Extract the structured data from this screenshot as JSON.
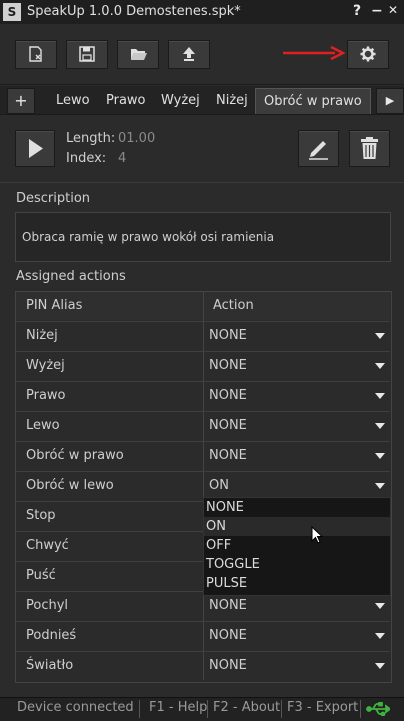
{
  "window": {
    "app_icon_text": "S",
    "title": "SpeakUp 1.0.0  Demostenes.spk*",
    "help": "?",
    "minimize": "−",
    "close": "✕"
  },
  "toolbar": {
    "buttons": [
      "new-file-icon",
      "save-icon",
      "open-folder-icon",
      "upload-icon"
    ],
    "settings_icon": "gear-icon",
    "annotation_color": "#e02020"
  },
  "tabs": {
    "add_label": "+",
    "items": [
      "Lewo",
      "Prawo",
      "Wyżej",
      "Niżej"
    ],
    "active": "Obróć w prawo",
    "next_label": "▶"
  },
  "playback": {
    "length_label": "Length:",
    "length_value": "01.00",
    "index_label": "Index:",
    "index_value": "4"
  },
  "description": {
    "label": "Description",
    "text": "Obraca ramię w prawo wokół osi ramienia"
  },
  "actions": {
    "label": "Assigned actions",
    "col_alias": "PIN Alias",
    "col_action": "Action",
    "rows": [
      {
        "alias": "Niżej",
        "action": "NONE"
      },
      {
        "alias": "Wyżej",
        "action": "NONE"
      },
      {
        "alias": "Prawo",
        "action": "NONE"
      },
      {
        "alias": "Lewo",
        "action": "NONE"
      },
      {
        "alias": "Obróć w prawo",
        "action": "NONE"
      },
      {
        "alias": "Obróć w lewo",
        "action": "ON"
      },
      {
        "alias": "Stop",
        "action": ""
      },
      {
        "alias": "Chwyć",
        "action": ""
      },
      {
        "alias": "Puść",
        "action": ""
      },
      {
        "alias": "Pochyl",
        "action": "NONE"
      },
      {
        "alias": "Podnieś",
        "action": "NONE"
      },
      {
        "alias": "Światło",
        "action": "NONE"
      }
    ],
    "dropdown_options": [
      "NONE",
      "ON",
      "OFF",
      "TOGGLE",
      "PULSE"
    ],
    "dropdown_highlighted": "ON"
  },
  "status": {
    "text": "Device connected",
    "f1": "F1 - Help",
    "f2": "F2 - About",
    "f3": "F3 - Export",
    "usb_color": "#3fb23f"
  }
}
